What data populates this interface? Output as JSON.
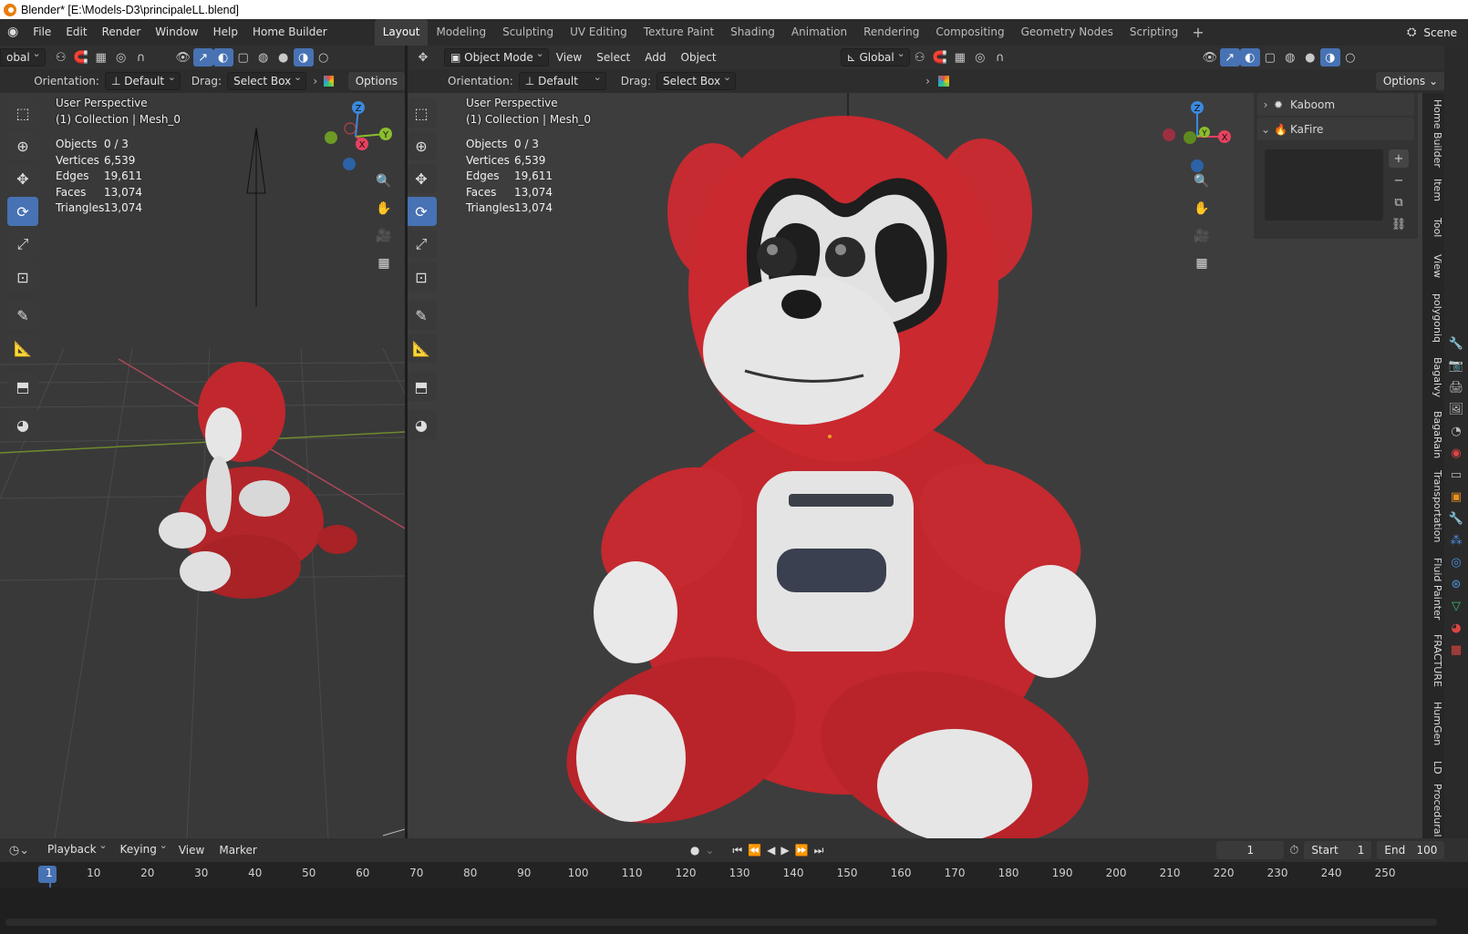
{
  "window": {
    "title": "Blender* [E:\\Models-D3\\principaleLL.blend]"
  },
  "menu": {
    "items": [
      "File",
      "Edit",
      "Render",
      "Window",
      "Help",
      "Home Builder"
    ]
  },
  "workspaces": {
    "tabs": [
      "Layout",
      "Modeling",
      "Sculpting",
      "UV Editing",
      "Texture Paint",
      "Shading",
      "Animation",
      "Rendering",
      "Compositing",
      "Geometry Nodes",
      "Scripting"
    ],
    "active": "Layout"
  },
  "scene": {
    "label": "Scene"
  },
  "left_view": {
    "header": {
      "transform_partial": "obal",
      "orientation_label": "Orientation:",
      "orientation_value": "Default",
      "drag_label": "Drag:",
      "drag_value": "Select Box",
      "options": "Options"
    },
    "overlay": {
      "perspective": "User Perspective",
      "collection": "(1) Collection | Mesh_0"
    },
    "stats": {
      "objects": "0 / 3",
      "vertices": "6,539",
      "edges": "19,611",
      "faces": "13,074",
      "triangles": "13,074"
    }
  },
  "right_view": {
    "header": {
      "mode": "Object Mode",
      "view": "View",
      "select": "Select",
      "add": "Add",
      "object": "Object",
      "transform": "Global",
      "orientation_label": "Orientation:",
      "orientation_value": "Default",
      "drag_label": "Drag:",
      "drag_value": "Select Box",
      "options": "Options"
    },
    "overlay": {
      "perspective": "User Perspective",
      "collection": "(1) Collection | Mesh_0"
    },
    "stats": {
      "objects": "0 / 3",
      "vertices": "6,539",
      "edges": "19,611",
      "faces": "13,074",
      "triangles": "13,074"
    }
  },
  "stat_labels": {
    "objects": "Objects",
    "vertices": "Vertices",
    "edges": "Edges",
    "faces": "Faces",
    "triangles": "Triangles"
  },
  "gizmo": {
    "x": "X",
    "y": "Y",
    "z": "Z"
  },
  "npanel": {
    "panels": [
      "Kaboom",
      "KaFire"
    ],
    "tabs": [
      "Home Builder",
      "Item",
      "Tool",
      "View",
      "polygoniq",
      "Bagalvy",
      "BagaRain",
      "Transportation",
      "Fluid Painter",
      "FRACTURE",
      "HumGen",
      "LD",
      "Procedural Cro"
    ]
  },
  "timeline": {
    "menu": [
      "Playback",
      "Keying",
      "View",
      "Marker"
    ],
    "current_frame": "1",
    "start_label": "Start",
    "start": "1",
    "end_label": "End",
    "end": "100",
    "ruler": [
      "1",
      "10",
      "20",
      "30",
      "40",
      "50",
      "60",
      "70",
      "80",
      "90",
      "100",
      "110",
      "120",
      "130",
      "140",
      "150",
      "160",
      "170",
      "180",
      "190",
      "200",
      "210",
      "220",
      "230",
      "240",
      "250"
    ]
  },
  "colors": {
    "bg": "#3d3d3d",
    "accent": "#4772b3",
    "axis_x": "#e8415f",
    "axis_y": "#8bbd2f",
    "axis_z": "#3b8ade",
    "bear_red": "#c92a2a"
  }
}
